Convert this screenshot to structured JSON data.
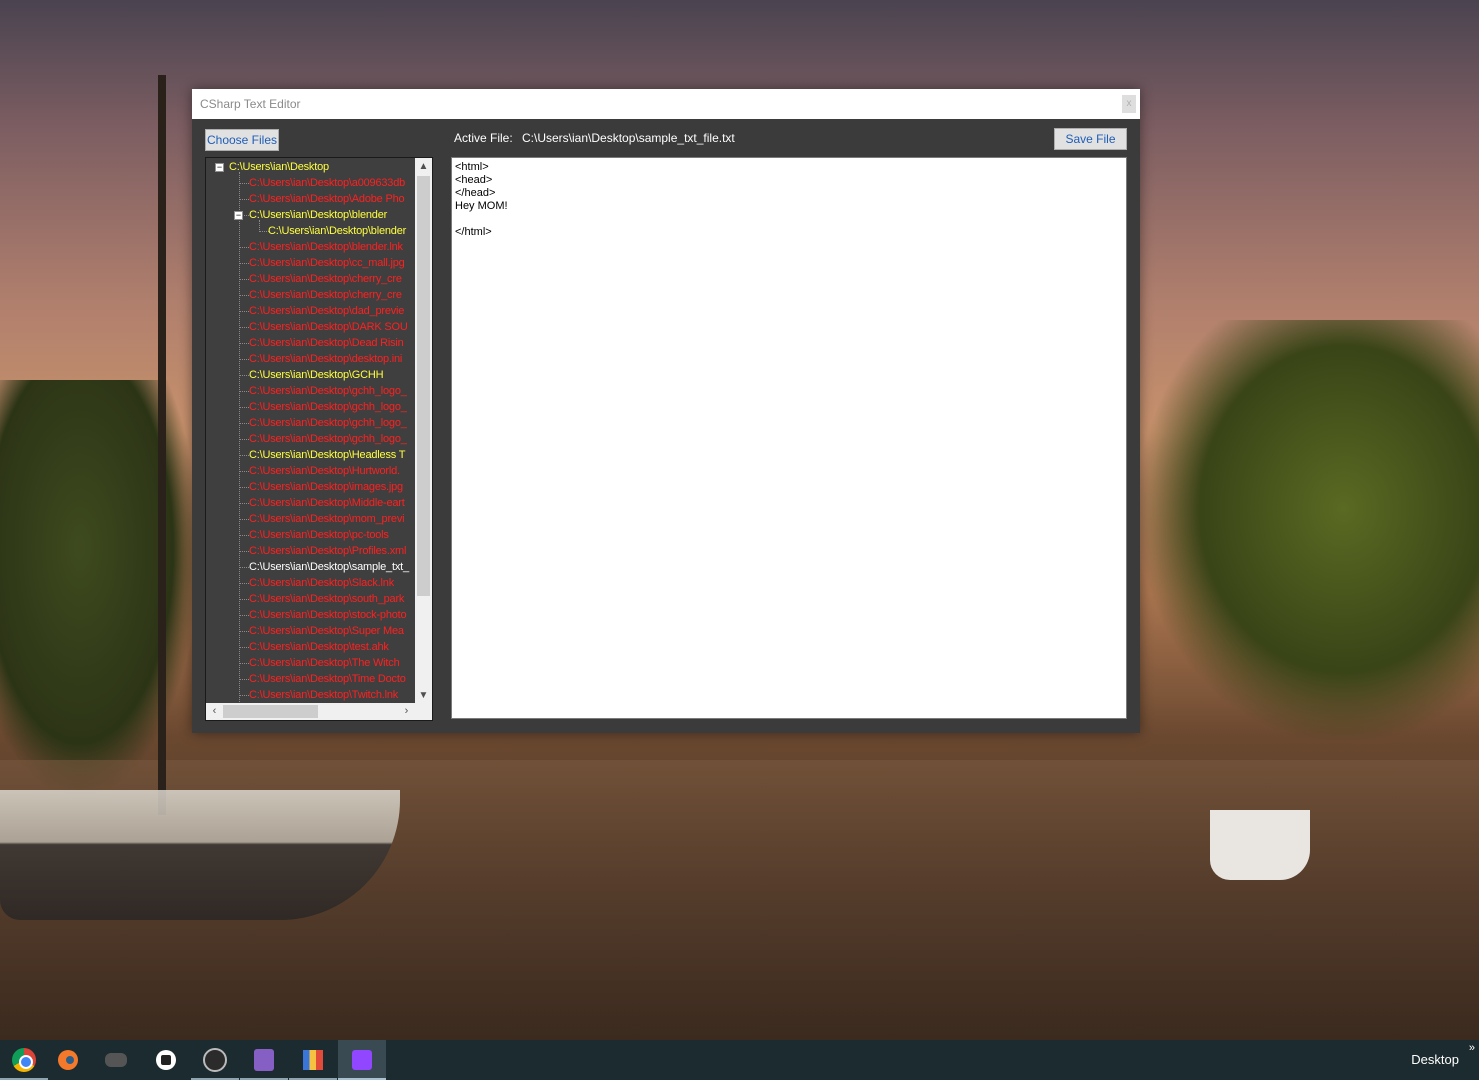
{
  "window": {
    "title": "CSharp Text Editor",
    "close_glyph": "x"
  },
  "toolbar": {
    "choose_files_label": "Choose Files",
    "active_file_label": "Active File:",
    "active_file_path": "C:\\Users\\ian\\Desktop\\sample_txt_file.txt",
    "save_file_label": "Save File"
  },
  "tree": {
    "root": "C:\\Users\\ian\\Desktop",
    "nodes": [
      {
        "text": "C:\\Users\\ian\\Desktop\\a009633db",
        "color": "#ff2020"
      },
      {
        "text": "C:\\Users\\ian\\Desktop\\Adobe Pho",
        "color": "#ff2020"
      },
      {
        "text": "C:\\Users\\ian\\Desktop\\blender",
        "color": "#ffff40"
      },
      {
        "text": "C:\\Users\\ian\\Desktop\\blender",
        "color": "#ffff40"
      },
      {
        "text": "C:\\Users\\ian\\Desktop\\blender.lnk",
        "color": "#ff2020"
      },
      {
        "text": "C:\\Users\\ian\\Desktop\\cc_mall.jpg",
        "color": "#ff2020"
      },
      {
        "text": "C:\\Users\\ian\\Desktop\\cherry_cre",
        "color": "#ff2020"
      },
      {
        "text": "C:\\Users\\ian\\Desktop\\cherry_cre",
        "color": "#ff2020"
      },
      {
        "text": "C:\\Users\\ian\\Desktop\\dad_previe",
        "color": "#ff2020"
      },
      {
        "text": "C:\\Users\\ian\\Desktop\\DARK SOU",
        "color": "#ff2020"
      },
      {
        "text": "C:\\Users\\ian\\Desktop\\Dead Risin",
        "color": "#ff2020"
      },
      {
        "text": "C:\\Users\\ian\\Desktop\\desktop.ini",
        "color": "#ff2020"
      },
      {
        "text": "C:\\Users\\ian\\Desktop\\GCHH",
        "color": "#ffff40"
      },
      {
        "text": "C:\\Users\\ian\\Desktop\\gchh_logo_",
        "color": "#ff2020"
      },
      {
        "text": "C:\\Users\\ian\\Desktop\\gchh_logo_",
        "color": "#ff2020"
      },
      {
        "text": "C:\\Users\\ian\\Desktop\\gchh_logo_",
        "color": "#ff2020"
      },
      {
        "text": "C:\\Users\\ian\\Desktop\\gchh_logo_",
        "color": "#ff2020"
      },
      {
        "text": "C:\\Users\\ian\\Desktop\\Headless T",
        "color": "#ffff40"
      },
      {
        "text": "C:\\Users\\ian\\Desktop\\Hurtworld.",
        "color": "#ff2020"
      },
      {
        "text": "C:\\Users\\ian\\Desktop\\images.jpg",
        "color": "#ff2020"
      },
      {
        "text": "C:\\Users\\ian\\Desktop\\Middle-eart",
        "color": "#ff2020"
      },
      {
        "text": "C:\\Users\\ian\\Desktop\\mom_previ",
        "color": "#ff2020"
      },
      {
        "text": "C:\\Users\\ian\\Desktop\\pc-tools",
        "color": "#ff2020"
      },
      {
        "text": "C:\\Users\\ian\\Desktop\\Profiles.xml",
        "color": "#ff2020"
      },
      {
        "text": "C:\\Users\\ian\\Desktop\\sample_txt_",
        "color": "#ffffff"
      },
      {
        "text": "C:\\Users\\ian\\Desktop\\Slack.lnk",
        "color": "#ff2020"
      },
      {
        "text": "C:\\Users\\ian\\Desktop\\south_park",
        "color": "#ff2020"
      },
      {
        "text": "C:\\Users\\ian\\Desktop\\stock-photo",
        "color": "#ff2020"
      },
      {
        "text": "C:\\Users\\ian\\Desktop\\Super Mea",
        "color": "#ff2020"
      },
      {
        "text": "C:\\Users\\ian\\Desktop\\test.ahk",
        "color": "#ff2020"
      },
      {
        "text": "C:\\Users\\ian\\Desktop\\The Witch",
        "color": "#ff2020"
      },
      {
        "text": "C:\\Users\\ian\\Desktop\\Time Docto",
        "color": "#ff2020"
      },
      {
        "text": "C:\\Users\\ian\\Desktop\\Twitch.lnk",
        "color": "#ff2020"
      }
    ]
  },
  "editor": {
    "content": "<html>\n<head>\n</head>\nHey MOM!\n\n</html>"
  },
  "taskbar": {
    "apps": [
      "chrome-icon",
      "blender-icon",
      "game-controller-icon",
      "slack-icon",
      "obs-icon",
      "visual-studio-icon",
      "file-explorer-icon",
      "twitch-icon"
    ],
    "desktop_label": "Desktop",
    "overflow_glyph": "»"
  }
}
